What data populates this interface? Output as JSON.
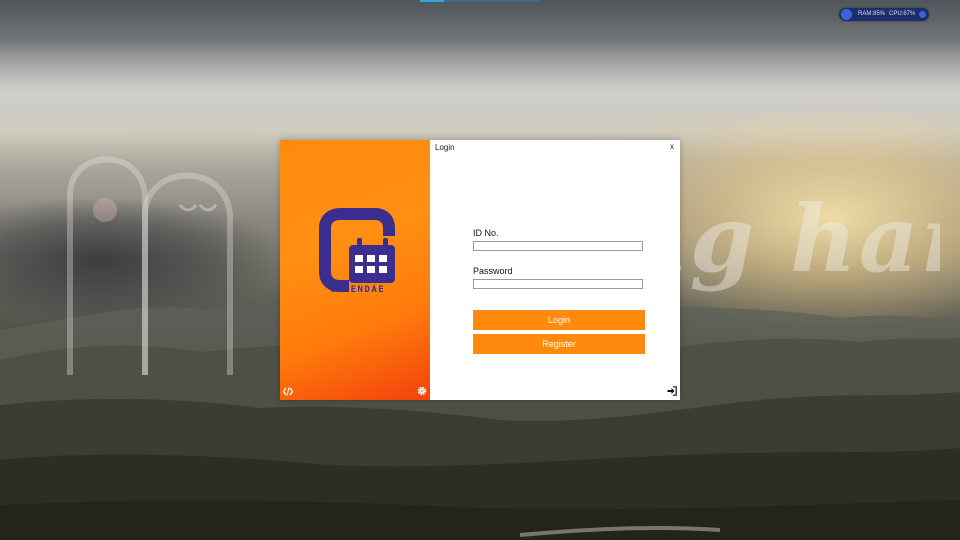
{
  "window": {
    "title": "Login",
    "close_label": "x"
  },
  "brand": {
    "logo_text": "CALENDAE",
    "logo_icon": "calendar-icon",
    "primary_color": "#ff8a0d",
    "logo_color": "#3b2e8f"
  },
  "form": {
    "id_label": "ID No.",
    "id_value": "",
    "password_label": "Password",
    "password_value": "",
    "login_button": "Login",
    "register_button": "Register"
  },
  "footer": {
    "code_icon": "code-icon",
    "settings_icon": "gear-icon",
    "exit_icon": "sign-in-icon"
  },
  "wallpaper": {
    "watermark": "elping hand"
  },
  "system_monitor": {
    "ram": "RAM:85%",
    "cpu": "CPU:67%"
  }
}
